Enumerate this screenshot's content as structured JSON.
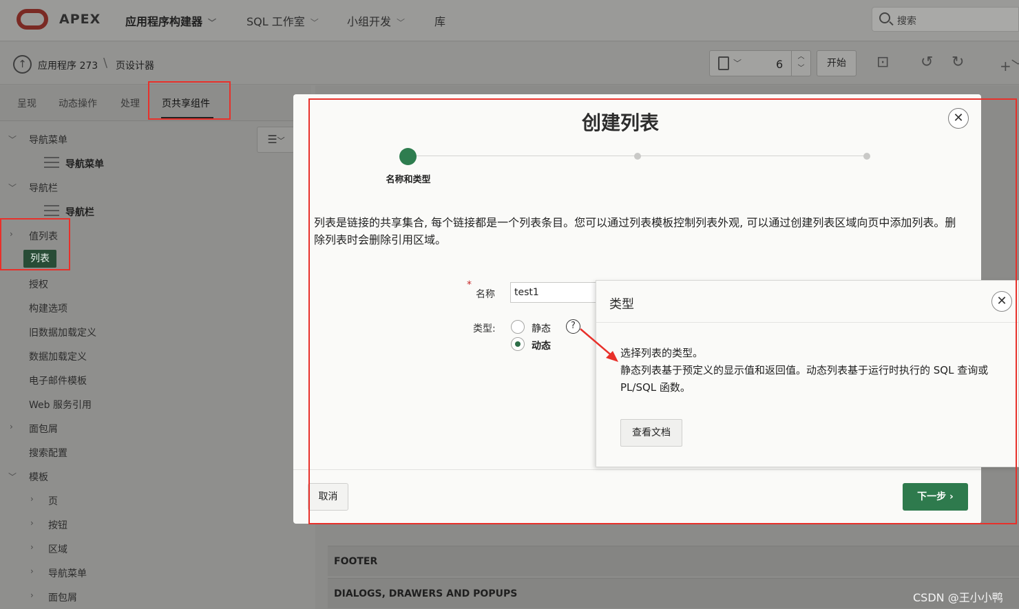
{
  "app": {
    "logo": "APEX",
    "nav": [
      "应用程序构建器",
      "SQL 工作室",
      "小组开发",
      "库"
    ],
    "search_placeholder": "搜索"
  },
  "breadcrumb": {
    "app": "应用程序 273",
    "page": "页设计器"
  },
  "toolbar": {
    "page_number": "6",
    "start_label": "开始"
  },
  "tabs": [
    "呈现",
    "动态操作",
    "处理",
    "页共享组件"
  ],
  "tree": {
    "nav_menu_group": "导航菜单",
    "nav_menu_item": "导航菜单",
    "nav_bar_group": "导航栏",
    "nav_bar_item": "导航栏",
    "lov": "值列表",
    "lists": "列表",
    "auth": "授权",
    "build_options": "构建选项",
    "legacy_data_load": "旧数据加载定义",
    "data_load": "数据加载定义",
    "email_templates": "电子邮件模板",
    "web_service": "Web 服务引用",
    "breadcrumbs": "面包屑",
    "search_config": "搜索配置",
    "templates": "模板",
    "tpl_page": "页",
    "tpl_button": "按钮",
    "tpl_region": "区域",
    "tpl_nav_menu": "导航菜单",
    "tpl_breadcrumb": "面包屑"
  },
  "regions": {
    "footer": "FOOTER",
    "dialogs": "DIALOGS, DRAWERS AND POPUPS"
  },
  "modal": {
    "title": "创建列表",
    "step1_label": "名称和类型",
    "description": "列表是链接的共享集合, 每个链接都是一个列表条目。您可以通过列表模板控制列表外观, 可以通过创建列表区域向页中添加列表。删除列表时会删除引用区域。",
    "name_label": "名称",
    "name_value": "test1",
    "type_label": "类型:",
    "type_static": "静态",
    "type_dynamic": "动态",
    "help_glyph": "?",
    "cancel_label": "取消",
    "next_label": "下一步 ›"
  },
  "popup": {
    "title": "类型",
    "line1": "选择列表的类型。",
    "line2": "静态列表基于预定义的显示值和返回值。动态列表基于运行时执行的 SQL 查询或 PL/SQL 函数。",
    "doc_button": "查看文档"
  },
  "watermark": "CSDN @王小小鸭",
  "colors": {
    "accent_green": "#2e7a4d",
    "highlight_red": "#e8302a",
    "logo_red": "#7a2a24"
  }
}
